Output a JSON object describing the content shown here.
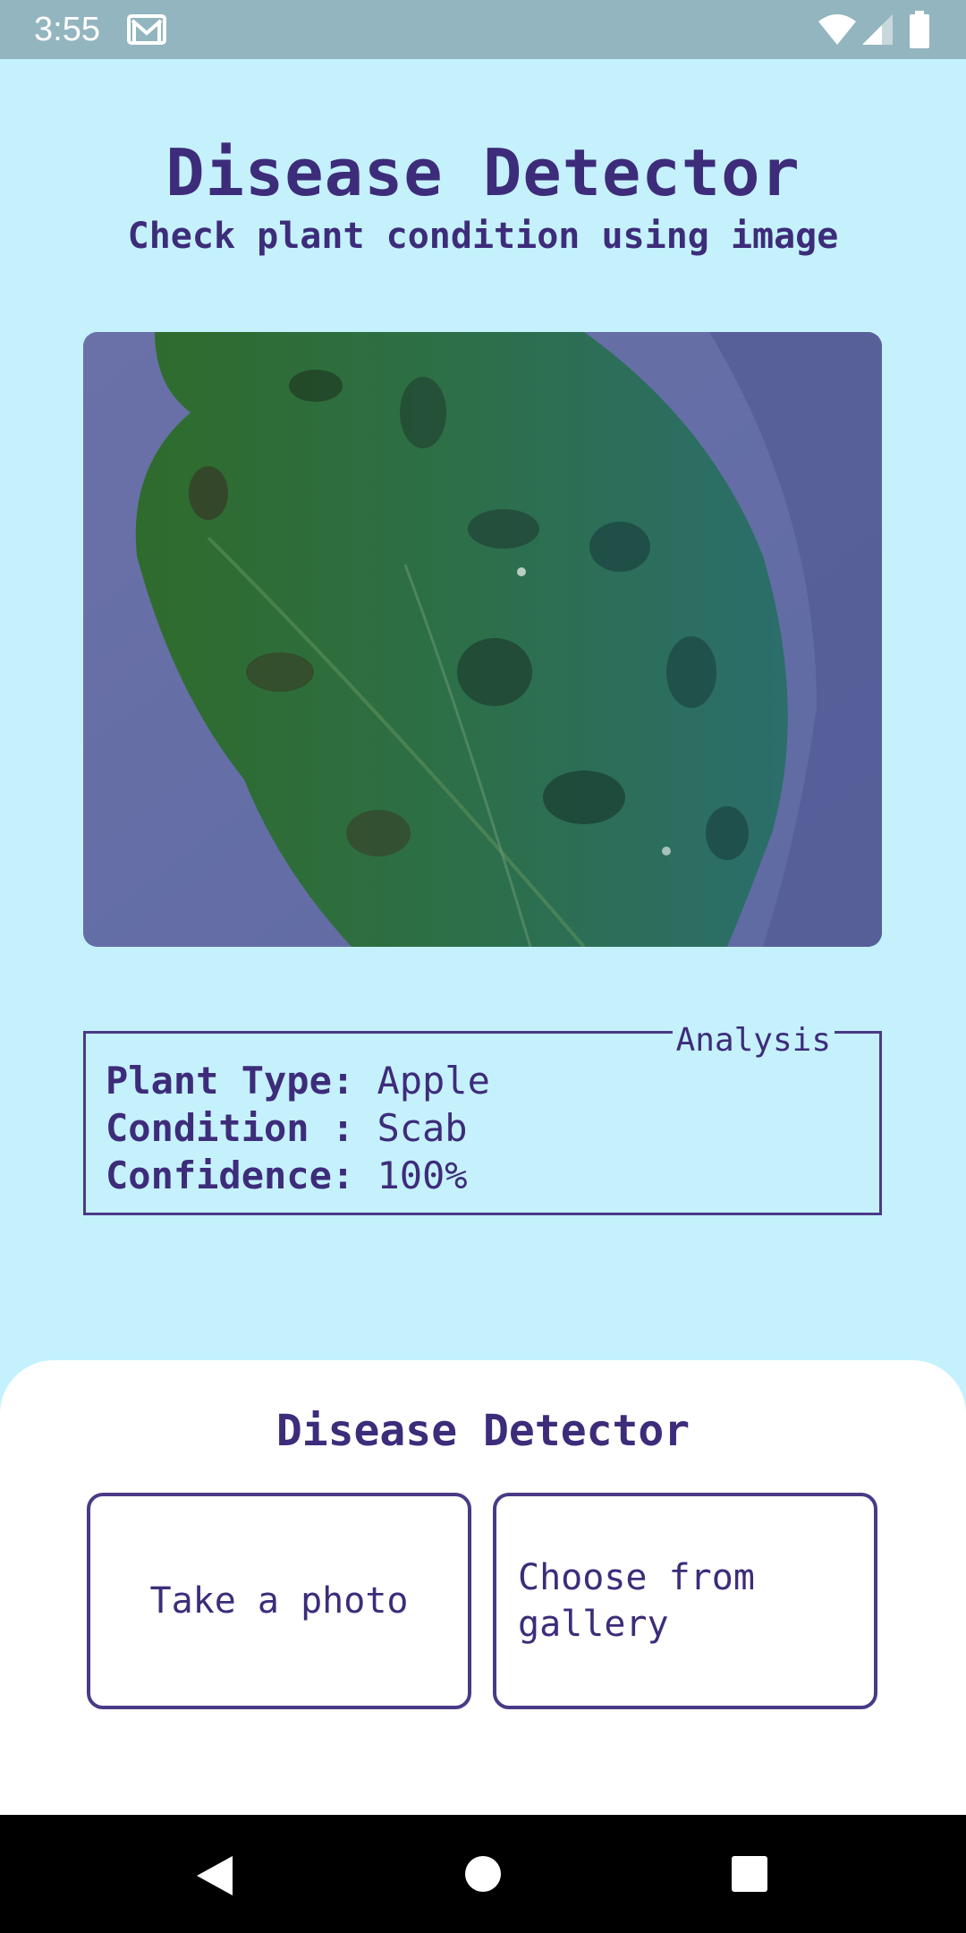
{
  "status_bar": {
    "time": "3:55",
    "icons": [
      "gmail-icon",
      "wifi-icon",
      "cell-signal-icon",
      "battery-icon"
    ]
  },
  "header": {
    "title": "Disease Detector",
    "subtitle": "Check plant condition using image"
  },
  "image": {
    "subject": "apple leaf with scab lesions"
  },
  "analysis": {
    "legend": "Analysis",
    "rows": [
      {
        "label": "Plant Type:",
        "value": " Apple"
      },
      {
        "label": "Condition :",
        "value": " Scab"
      },
      {
        "label": "Confidence:",
        "value": " 100%"
      }
    ]
  },
  "bottom_sheet": {
    "title": "Disease Detector",
    "take_photo_label": "Take a photo",
    "gallery_label": "Choose from gallery"
  },
  "nav_bar": {
    "icons": [
      "back-icon",
      "home-icon",
      "recents-icon"
    ]
  },
  "colors": {
    "background": "#c5f1fd",
    "accent": "#3d2c7a",
    "status_bar": "#93b5bf",
    "sheet": "#ffffff"
  }
}
